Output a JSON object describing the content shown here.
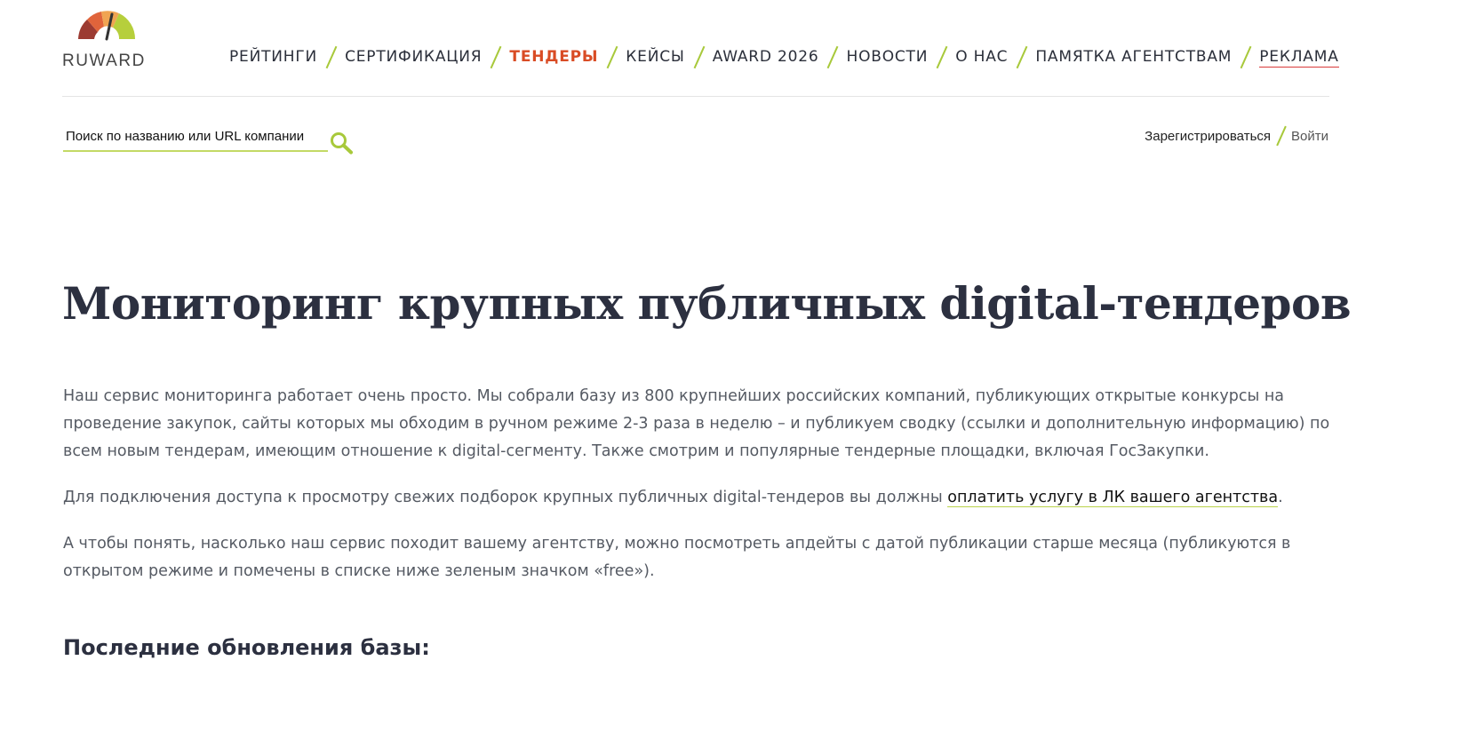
{
  "logo": {
    "text": "RUWARD"
  },
  "nav": {
    "items": [
      {
        "label": "РЕЙТИНГИ"
      },
      {
        "label": "СЕРТИФИКАЦИЯ"
      },
      {
        "label": "ТЕНДЕРЫ"
      },
      {
        "label": "КЕЙСЫ"
      },
      {
        "label": "AWARD 2026"
      },
      {
        "label": "НОВОСТИ"
      },
      {
        "label": "О НАС"
      },
      {
        "label": "ПАМЯТКА АГЕНТСТВАМ"
      },
      {
        "label": "РЕКЛАМА"
      }
    ],
    "active_color": "#d94c25",
    "separator_color": "#a8c93b"
  },
  "search": {
    "placeholder": "Поиск по названию или URL компании",
    "icon": "search-icon"
  },
  "auth": {
    "register_label": "Зарегистрироваться",
    "login_label": "Войти"
  },
  "page": {
    "title": "Мониторинг крупных публичных digital-тендеров",
    "paragraph1": "Наш сервис мониторинга работает очень просто. Мы собрали базу из 800 крупнейших российских компаний, публикующих открытые конкурсы на проведение закупок, сайты которых мы обходим в ручном режиме 2-3 раза в неделю – и публикуем сводку (ссылки и дополнительную информацию) по всем новым тендерам, имеющим отношение к digital-сегменту. Также смотрим и популярные тендерные площадки, включая ГосЗакупки.",
    "paragraph2_before": "Для подключения доступа к просмотру свежих подборок крупных публичных digital-тендеров вы должны ",
    "paragraph2_link": "оплатить услугу в ЛК вашего агентства",
    "paragraph2_after": ".",
    "paragraph3": "А чтобы понять, насколько наш сервис походит вашему агентству, можно посмотреть апдейты с датой публикации старше месяца (публикуются в открытом режиме и помечены в списке ниже зеленым значком «free»).",
    "section_title": "Последние обновления базы:"
  }
}
